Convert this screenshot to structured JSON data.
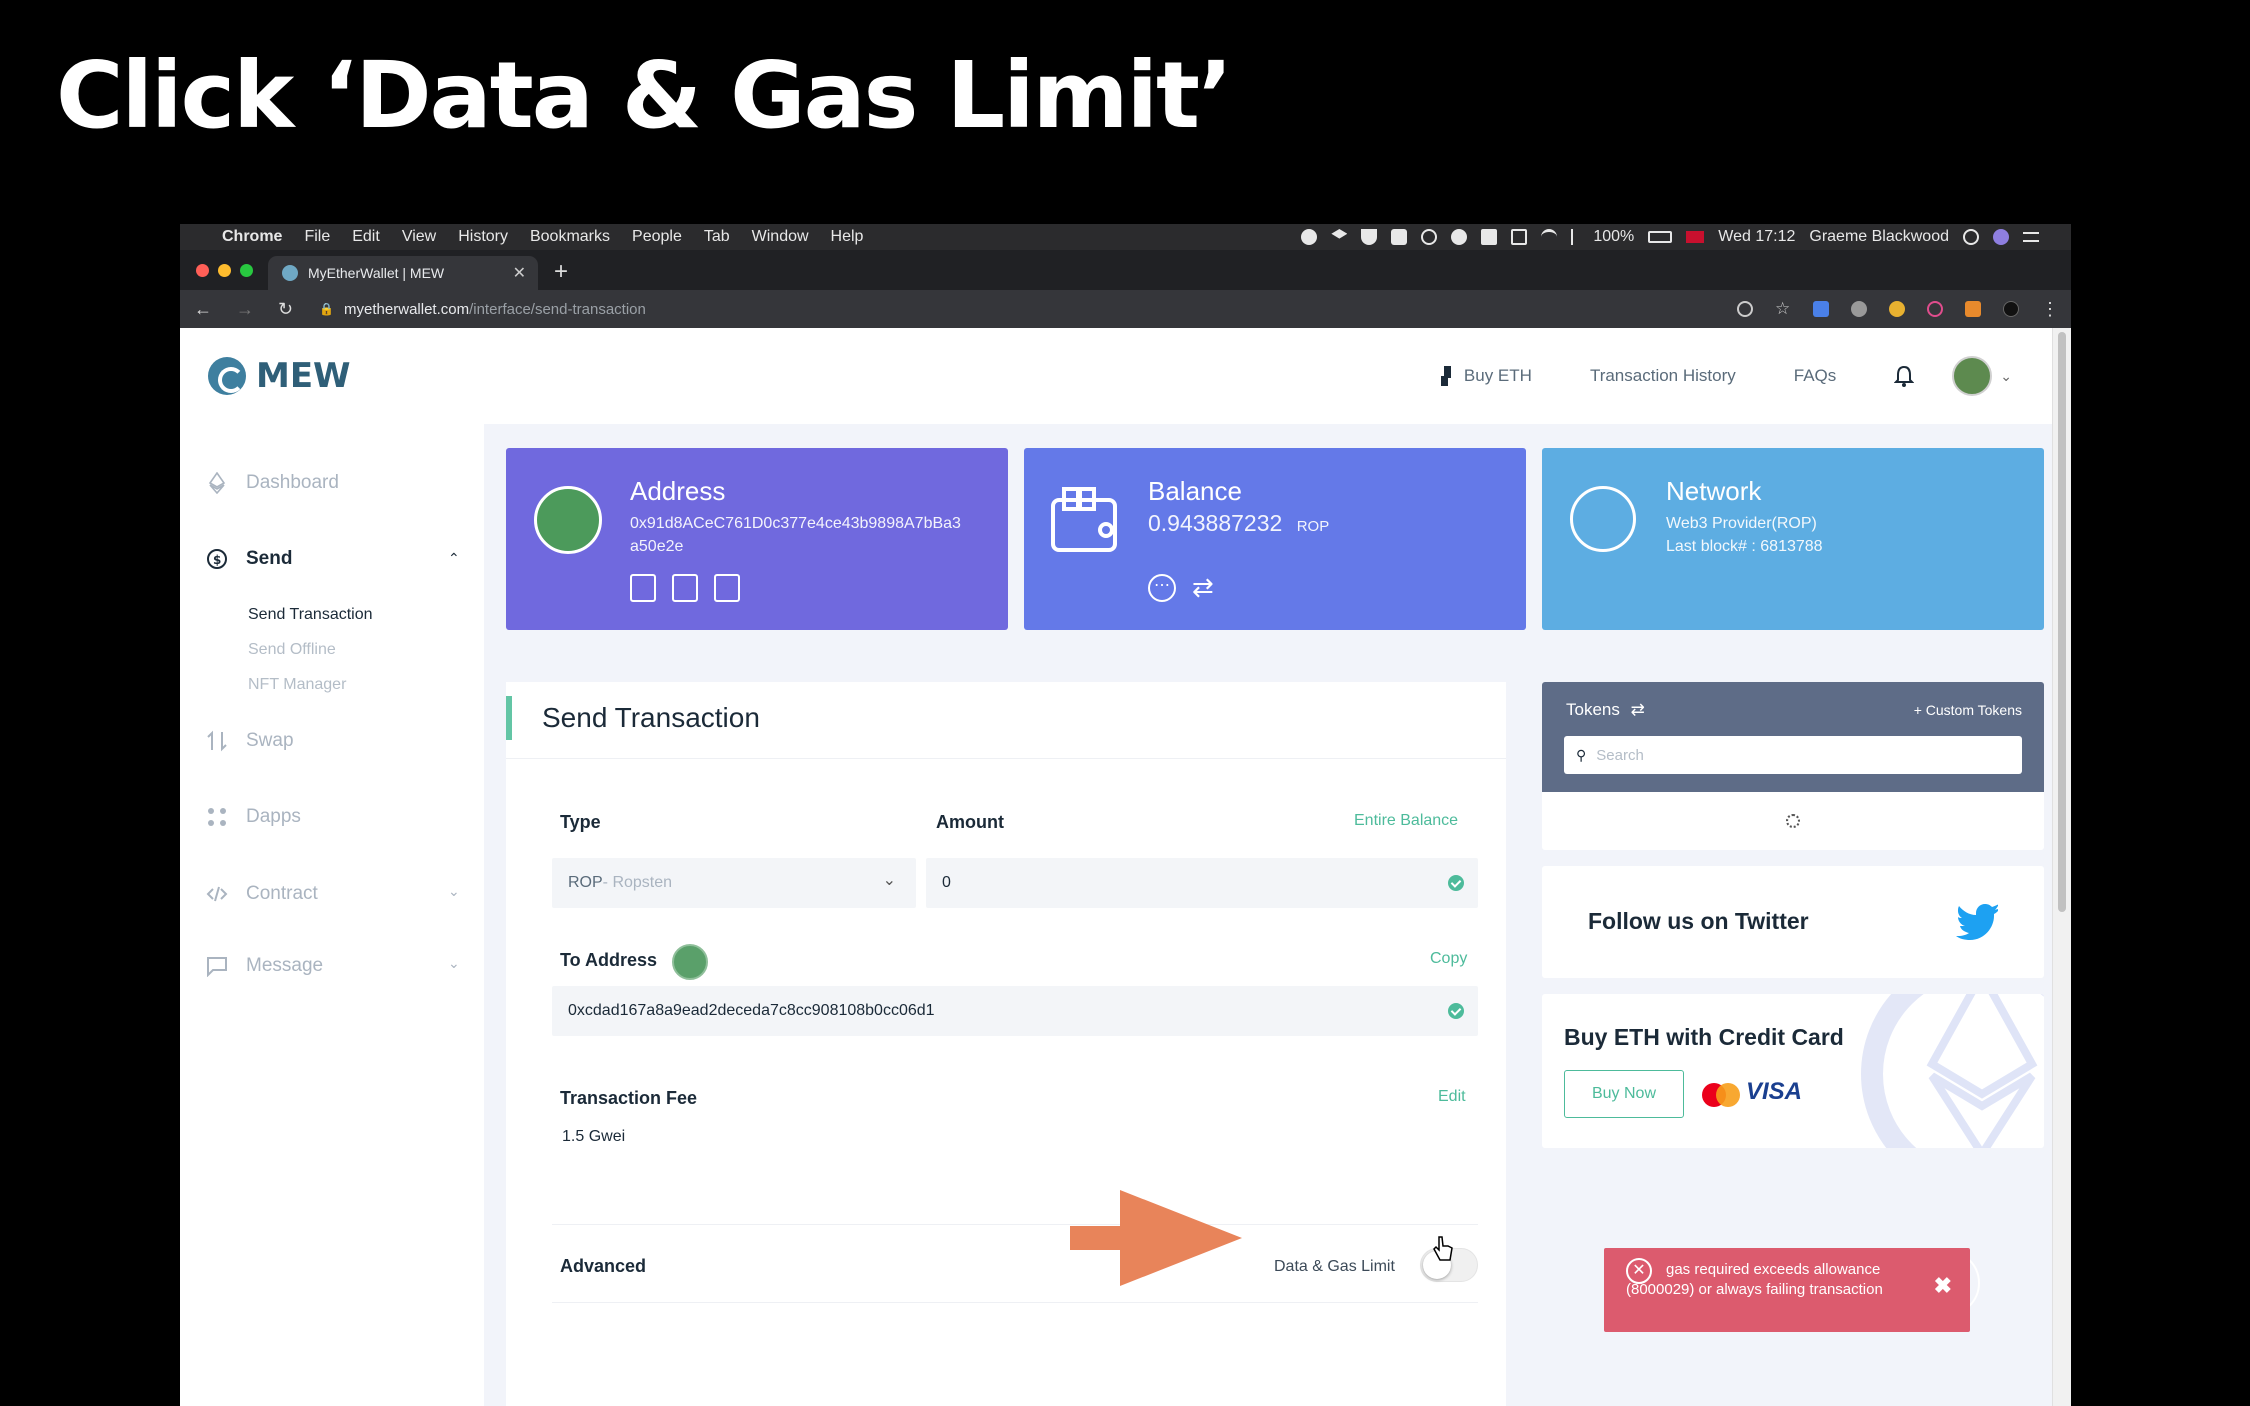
{
  "heading": "Click ‘Data & Gas Limit’",
  "menubar": {
    "app": "Chrome",
    "items": [
      "File",
      "Edit",
      "View",
      "History",
      "Bookmarks",
      "People",
      "Tab",
      "Window",
      "Help"
    ],
    "battery": "100%",
    "datetime": "Wed 17:12",
    "user": "Graeme Blackwood"
  },
  "browser": {
    "tab_title": "MyEtherWallet | MEW",
    "url_host": "myetherwallet.com",
    "url_path": "/interface/send-transaction"
  },
  "topnav": {
    "logo": "MEW",
    "buy_eth": "Buy ETH",
    "history": "Transaction History",
    "faqs": "FAQs"
  },
  "sidebar": {
    "dashboard": "Dashboard",
    "send": "Send",
    "send_transaction": "Send Transaction",
    "send_offline": "Send Offline",
    "nft_manager": "NFT Manager",
    "swap": "Swap",
    "dapps": "Dapps",
    "contract": "Contract",
    "message": "Message"
  },
  "cards": {
    "address_title": "Address",
    "address_value": "0x91d8ACeC761D0c377e4ce43b9898A7bBa3a50e2e",
    "address_line1": "0x91d8ACeC761D0c377e4ce43b9898A7bBa3",
    "address_line2": "a50e2e",
    "balance_title": "Balance",
    "balance_value": "0.943887232",
    "balance_unit": "ROP",
    "network_title": "Network",
    "network_provider": "Web3 Provider(ROP)",
    "network_block": "Last block# : 6813788"
  },
  "send": {
    "title": "Send Transaction",
    "type_label": "Type",
    "type_value": "ROP",
    "type_network": " - Ropsten",
    "amount_label": "Amount",
    "entire_balance": "Entire Balance",
    "amount_value": "0",
    "to_label": "To Address",
    "copy": "Copy",
    "to_value": "0xcdad167a8a9ead2deceda7c8cc908108b0cc06d1",
    "fee_label": "Transaction Fee",
    "edit": "Edit",
    "fee_value": "1.5 Gwei",
    "advanced": "Advanced",
    "data_gas": "Data & Gas Limit"
  },
  "tokens": {
    "title": "Tokens",
    "custom": "+ Custom Tokens",
    "search_placeholder": "Search"
  },
  "twitter": {
    "text": "Follow us on Twitter"
  },
  "buy": {
    "title": "Buy ETH with Credit Card",
    "button": "Buy Now",
    "visa": "VISA"
  },
  "toast": {
    "message": "gas required exceeds allowance (8000029) or always failing transaction"
  },
  "colors": {
    "address_card": "#7069de",
    "balance_card": "#6479e8",
    "network_card": "#5dade2",
    "accent": "#4dbb9b",
    "toast": "#dc5b6e",
    "arrow": "#e8845a"
  }
}
